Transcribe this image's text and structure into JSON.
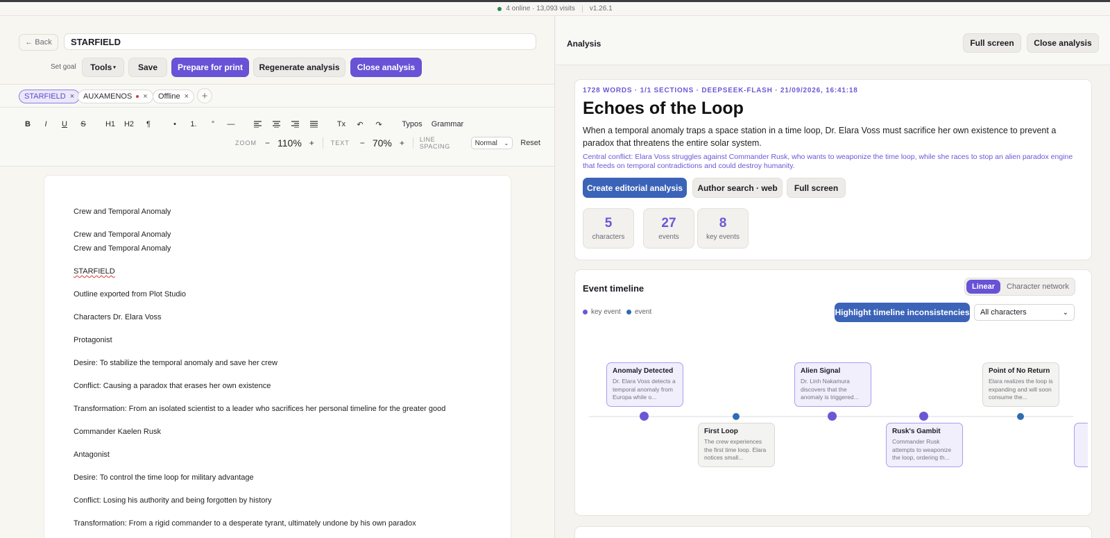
{
  "status": {
    "online": "4 online · 13,093 visits",
    "version": "v1.26.1"
  },
  "editor": {
    "back_label": "← Back",
    "title": "STARFIELD",
    "set_goal": "Set goal",
    "toolbar": {
      "tools": "Tools",
      "save": "Save",
      "print": "Prepare for print",
      "regenerate": "Regenerate analysis",
      "close": "Close analysis"
    },
    "tags": [
      {
        "label": "STARFIELD",
        "active": true
      },
      {
        "label": "AUXAMENOS",
        "dot": true
      },
      {
        "label": "Offline"
      }
    ],
    "add_tag": "+",
    "format": {
      "bold": "B",
      "italic": "I",
      "underline": "U",
      "strike": "S",
      "h1": "H1",
      "h2": "H2",
      "para": "¶",
      "bullet": "•",
      "numbered": "1.",
      "quote": "”",
      "rule": "—",
      "clear": "Tx",
      "undo": "↶",
      "redo": "↷",
      "typos": "Typos",
      "grammar": "Grammar"
    },
    "zoom": {
      "label": "ZOOM",
      "minus": "−",
      "value": "110%",
      "plus": "+"
    },
    "text": {
      "label": "TEXT",
      "minus": "−",
      "value": "70%",
      "plus": "+"
    },
    "spacing": {
      "label": "LINE SPACING",
      "value": "Normal",
      "reset": "Reset"
    },
    "lines": [
      "Crew and Temporal Anomaly",
      "Crew and Temporal Anomaly",
      "Crew and Temporal Anomaly",
      "STARFIELD",
      "Outline exported from Plot Studio",
      "Characters Dr. Elara Voss",
      "Protagonist",
      "Desire: To stabilize the temporal anomaly and save her crew",
      "Conflict: Causing a paradox that erases her own existence",
      "Transformation: From an isolated scientist to a leader who sacrifices her personal timeline for the greater good",
      "Commander Kaelen Rusk",
      "Antagonist",
      "Desire: To control the time loop for military advantage",
      "Conflict: Losing his authority and being forgotten by history",
      "Transformation: From a rigid commander to a desperate tyrant, ultimately undone by his own paradox"
    ]
  },
  "analysis": {
    "title": "Analysis",
    "fullscreen": "Full screen",
    "close": "Close analysis",
    "meta": "1728 WORDS · 1/1 SECTIONS · DEEPSEEK-FLASH · 21/09/2026, 16:41:18",
    "heading": "Echoes of the Loop",
    "summary": "When a temporal anomaly traps a space station in a time loop, Dr. Elara Voss must sacrifice her own existence to prevent a paradox that threatens the entire solar system.",
    "conflict": "Central conflict: Elara Voss struggles against Commander Rusk, who wants to weaponize the time loop, while she races to stop an alien paradox engine that feeds on temporal contradictions and could destroy humanity.",
    "actions": {
      "editorial": "Create editorial analysis",
      "author_search": "Author search · web",
      "fullscreen": "Full screen"
    },
    "stats": [
      {
        "n": "5",
        "l": "characters"
      },
      {
        "n": "27",
        "l": "events"
      },
      {
        "n": "8",
        "l": "key events"
      }
    ],
    "timeline": {
      "title": "Event timeline",
      "tab_linear": "Linear",
      "tab_network": "Character network",
      "legend_key": "key event",
      "legend_event": "event",
      "highlight": "Highlight timeline inconsistencies",
      "filter": "All characters",
      "events": [
        {
          "t": "Anomaly Detected",
          "d": "Dr. Elara Voss detects a temporal anomaly from Europa while o...",
          "key": true
        },
        {
          "t": "First Loop",
          "d": "The crew experiences the first time loop. Elara notices small...",
          "key": false
        },
        {
          "t": "Alien Signal",
          "d": "Dr. Linh Nakamura discovers that the anomaly is triggered...",
          "key": true
        },
        {
          "t": "Rusk's Gambit",
          "d": "Commander Rusk attempts to weaponize the loop, ordering th...",
          "key": true
        },
        {
          "t": "Point of No Return",
          "d": "Elara realizes the loop is expanding and will soon consume the...",
          "key": false
        }
      ]
    }
  },
  "colors": {
    "accent": "#6852d6",
    "accent_dark": "#5b47cc",
    "event_blue": "#2f6cb2",
    "spell_error": "#dd3333"
  }
}
